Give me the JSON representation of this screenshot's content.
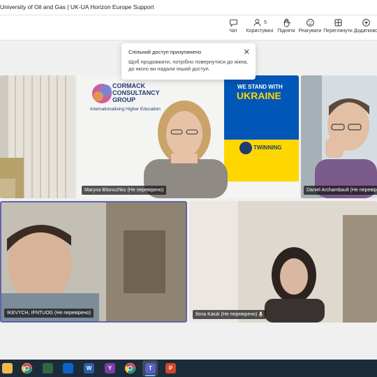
{
  "window": {
    "title": "University of Oil and Gas | UK-UA Horizon Europe Support"
  },
  "toolbar": {
    "items": [
      {
        "label": "Чат",
        "icon": "chat-icon"
      },
      {
        "label": "Користувачі",
        "icon": "people-icon",
        "count": "5"
      },
      {
        "label": "Підняти",
        "icon": "raise-hand-icon"
      },
      {
        "label": "Реагувати",
        "icon": "react-icon"
      },
      {
        "label": "Переглянути",
        "icon": "view-icon"
      },
      {
        "label": "Додатково",
        "icon": "apps-icon"
      }
    ]
  },
  "notice": {
    "title": "Спільний доступ призупинено",
    "body": "Щоб продовжити, потрібно повернутися до вікна, до якого ви надали інший доступ."
  },
  "participants": [
    {
      "name": "",
      "id": "tile-top-left"
    },
    {
      "name": "Maryna Bilonozhko (Не перевірено)",
      "id": "tile-maryna"
    },
    {
      "name": "Daniel Archambault (Не перевірено)",
      "id": "tile-daniel"
    },
    {
      "name": "IKEVYCH, IFNTUOG (Не перевірено)",
      "id": "tile-active-speaker"
    },
    {
      "name": "Ilona Kaiuk (Не перевірено)",
      "id": "tile-ilona"
    }
  ],
  "banner": {
    "org_line1": "CORMACK",
    "org_line2": "CONSULTANCY",
    "org_line3": "GROUP",
    "tagline": "Internationalising Higher Education",
    "stand1": "WE STAND WITH",
    "stand2": "UKRAINE",
    "twinning": "TWINNING"
  },
  "colors": {
    "accent": "#6264a7",
    "ukraine_blue": "#0057b7",
    "ukraine_yellow": "#ffd700"
  }
}
